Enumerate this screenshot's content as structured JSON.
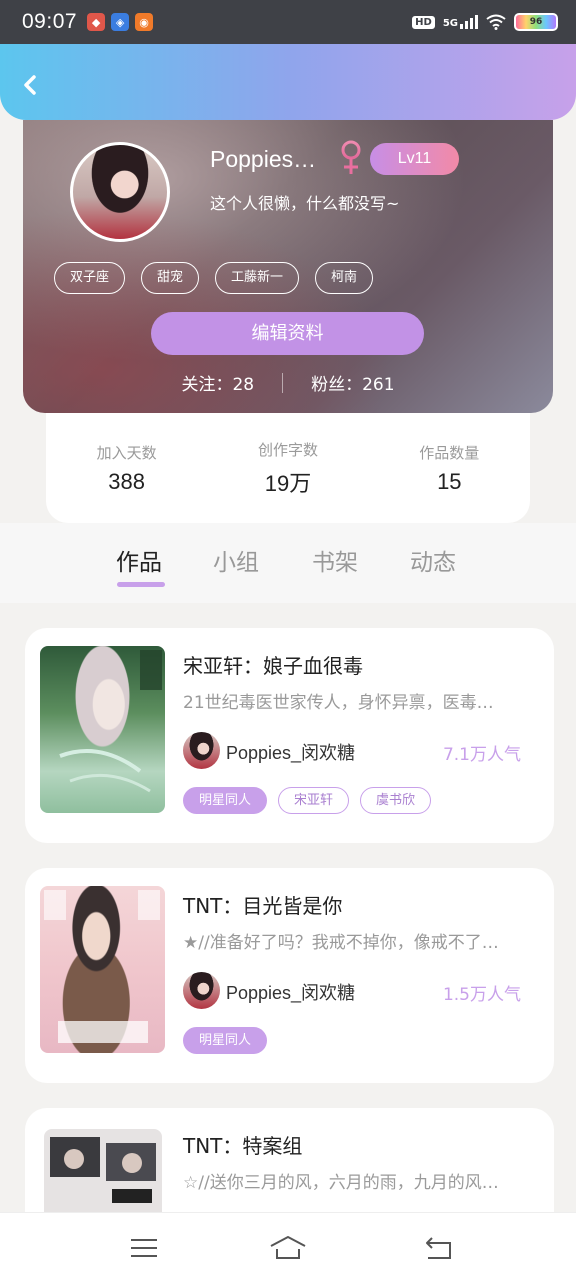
{
  "status_bar": {
    "time": "09:07",
    "network": "5G",
    "hd": "HD",
    "battery": "96"
  },
  "profile": {
    "nickname": "Poppies…",
    "level": "Lv11",
    "bio": "这个人很懒，什么都没写~",
    "tags": [
      "双子座",
      "甜宠",
      "工藤新一",
      "柯南"
    ],
    "edit_button": "编辑资料",
    "following_label": "关注：",
    "following_count": "28",
    "fans_label": "粉丝：",
    "fans_count": "261"
  },
  "stats": [
    {
      "label": "加入天数",
      "value": "388"
    },
    {
      "label": "创作字数",
      "value": "19万"
    },
    {
      "label": "作品数量",
      "value": "15"
    }
  ],
  "tabs": [
    "作品",
    "小组",
    "书架",
    "动态"
  ],
  "works": [
    {
      "title": "宋亚轩：娘子血很毒",
      "description": "21世纪毒医世家传人，身怀异禀，医毒…",
      "author": "Poppies_闵欢糖",
      "popularity": "7.1万人气",
      "tags": [
        "明星同人",
        "宋亚轩",
        "虞书欣"
      ]
    },
    {
      "title": "TNT：目光皆是你",
      "description": "★//准备好了吗？我戒不掉你，像戒不了…",
      "author": "Poppies_闵欢糖",
      "popularity": "1.5万人气",
      "tags": [
        "明星同人"
      ]
    },
    {
      "title": "TNT：特案组",
      "description": "☆//送你三月的风，六月的雨，九月的风…",
      "author": "",
      "popularity": "",
      "tags": []
    }
  ],
  "colors": {
    "accent": "#c8a0ea",
    "header_start": "#5cc6ee",
    "header_end": "#c7a1ea",
    "level_start": "#c78ee6",
    "level_end": "#f28aa7"
  },
  "icons": {
    "back": "chevron-left-icon",
    "gender": "female-icon",
    "nav": [
      "menu-icon",
      "home-icon",
      "return-icon"
    ]
  }
}
